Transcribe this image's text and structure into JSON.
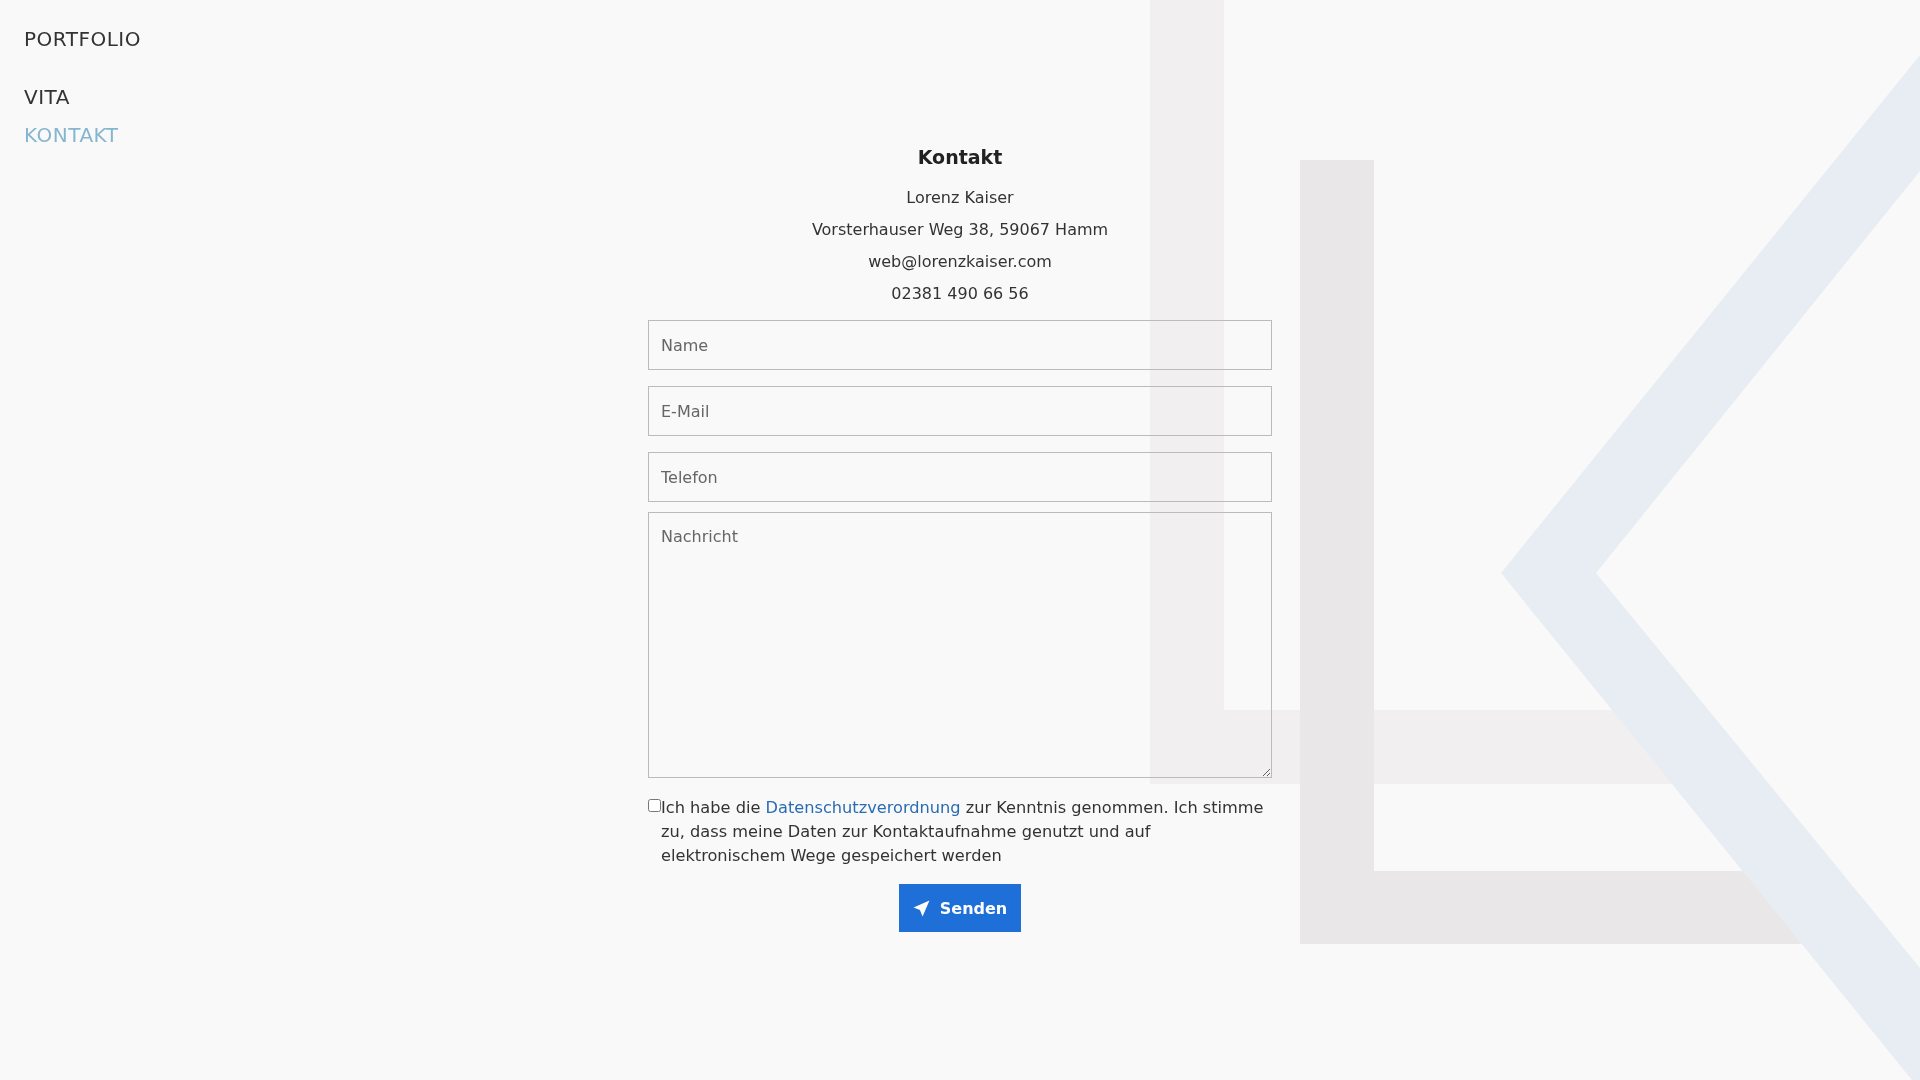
{
  "nav": [
    {
      "label": "PORTFOLIO",
      "selected": false
    },
    {
      "label": "VITA",
      "selected": false
    },
    {
      "label": "KONTAKT",
      "selected": true
    }
  ],
  "contact": {
    "title": "Kontakt",
    "lines": [
      "Lorenz Kaiser",
      "Vorsterhauser Weg 38, 59067 Hamm",
      "web@lorenzkaiser.com",
      "02381 490 66 56"
    ]
  },
  "form": {
    "fields": [
      {
        "kind": "input",
        "placeholder": "Name"
      },
      {
        "kind": "input",
        "placeholder": "E-Mail"
      },
      {
        "kind": "input",
        "placeholder": "Telefon"
      },
      {
        "kind": "textarea",
        "placeholder": "Nachricht"
      }
    ],
    "consent": {
      "checked": false,
      "before": "Ich habe die ",
      "link": "Datenschutzverordnung",
      "after": " zur Kenntnis genommen. Ich stimme zu, dass meine Daten zur Kontaktaufnahme genutzt und auf elektronischem Wege gespeichert werden"
    },
    "submit": "Senden"
  }
}
